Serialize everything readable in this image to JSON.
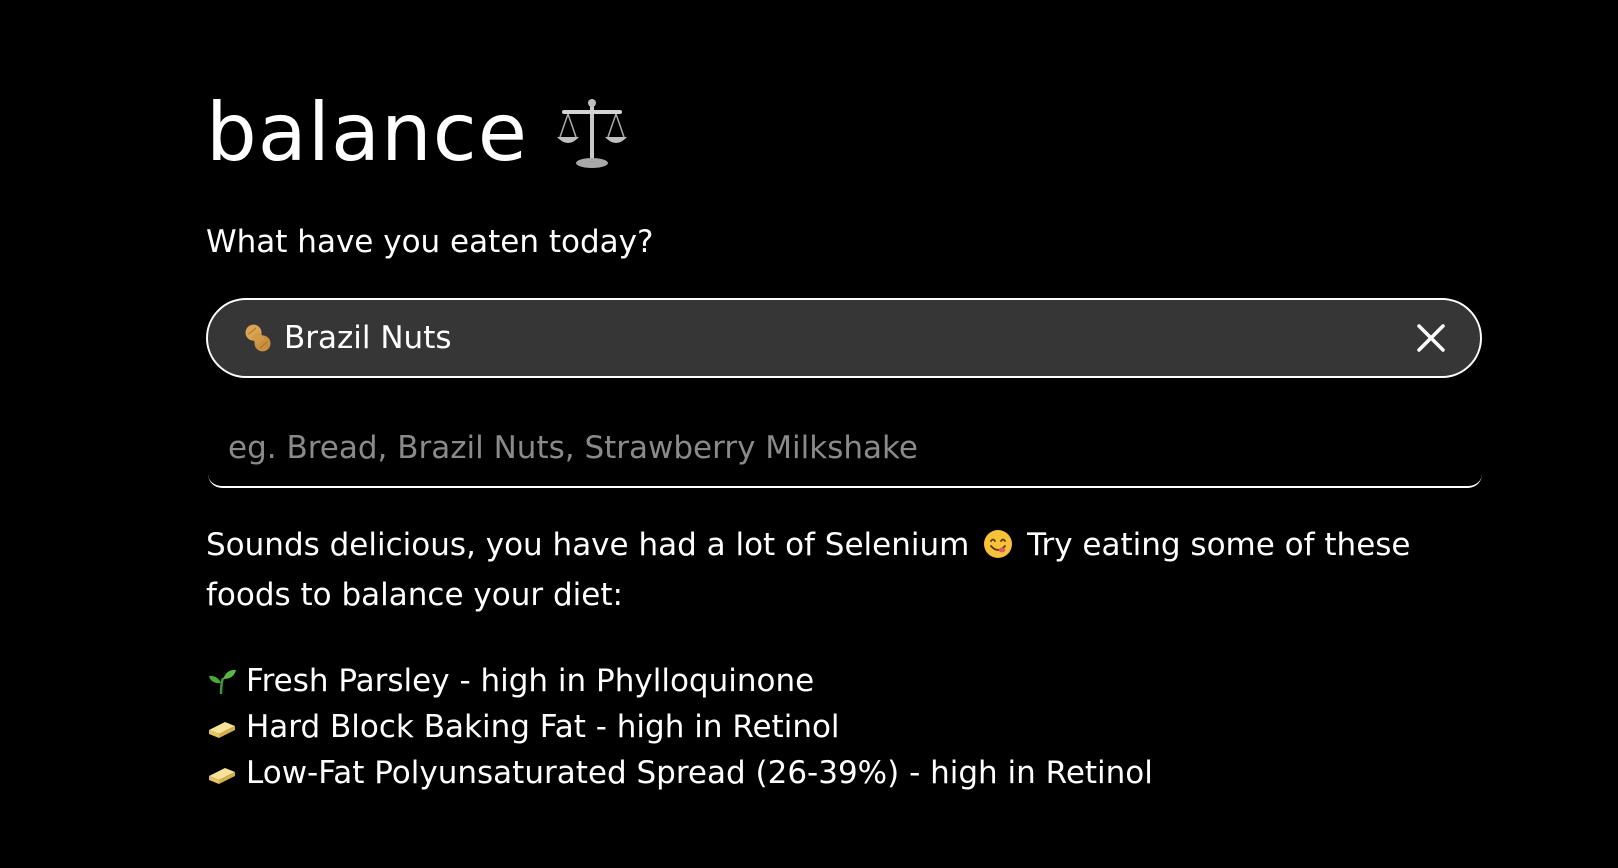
{
  "app": {
    "title": "balance",
    "title_icon": "balance-scale-icon"
  },
  "prompt": "What have you eaten today?",
  "selected_foods": [
    {
      "icon": "peanut-icon",
      "label": "Brazil Nuts"
    }
  ],
  "input": {
    "placeholder": "eg. Bread, Brazil Nuts, Strawberry Milkshake",
    "value": ""
  },
  "suggestion": {
    "text_before": "Sounds delicious, you have had a lot of Selenium",
    "emoji": "face-savoring-food-icon",
    "text_after": "Try eating some of these foods to balance your diet:"
  },
  "recommendations": [
    {
      "icon": "seedling-icon",
      "label": "Fresh Parsley - high in Phylloquinone"
    },
    {
      "icon": "butter-icon",
      "label": "Hard Block Baking Fat - high in Retinol"
    },
    {
      "icon": "butter-icon",
      "label": "Low-Fat Polyunsaturated Spread (26-39%) - high in Retinol"
    }
  ],
  "colors": {
    "background": "#000000",
    "text": "#ffffff",
    "chip_bg": "#363636",
    "placeholder": "#8a8a8a"
  }
}
